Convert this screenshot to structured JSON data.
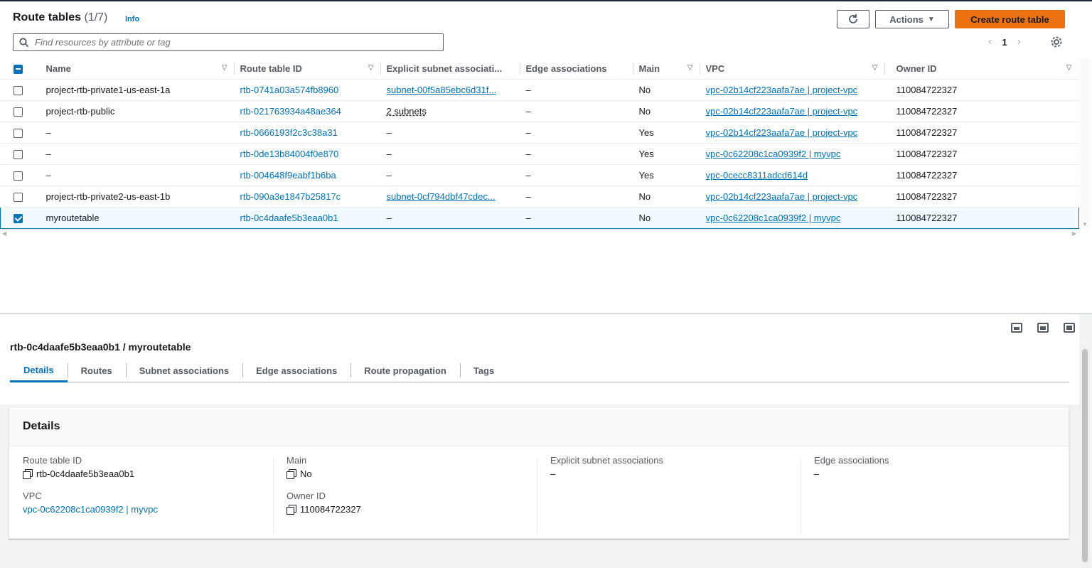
{
  "header": {
    "title": "Route tables",
    "count": "(1/7)",
    "info": "Info",
    "actions_label": "Actions",
    "create_label": "Create route table"
  },
  "search": {
    "placeholder": "Find resources by attribute or tag"
  },
  "pager": {
    "page": "1"
  },
  "table": {
    "columns": [
      "Name",
      "Route table ID",
      "Explicit subnet associati...",
      "Edge associations",
      "Main",
      "VPC",
      "Owner ID"
    ],
    "rows": [
      {
        "checked": false,
        "name": "project-rtb-private1-us-east-1a",
        "id": "rtb-0741a03a574fb8960",
        "subnet": "subnet-00f5a85ebc6d31f...",
        "edge": "–",
        "main": "No",
        "vpc": "vpc-02b14cf223aafa7ae | project-vpc",
        "owner": "110084722327"
      },
      {
        "checked": false,
        "name": "project-rtb-public",
        "id": "rtb-021763934a48ae364",
        "subnet": "2 subnets",
        "edge": "–",
        "main": "No",
        "vpc": "vpc-02b14cf223aafa7ae | project-vpc",
        "owner": "110084722327"
      },
      {
        "checked": false,
        "name": "–",
        "id": "rtb-0666193f2c3c38a31",
        "subnet": "–",
        "edge": "–",
        "main": "Yes",
        "vpc": "vpc-02b14cf223aafa7ae | project-vpc",
        "owner": "110084722327"
      },
      {
        "checked": false,
        "name": "–",
        "id": "rtb-0de13b84004f0e870",
        "subnet": "–",
        "edge": "–",
        "main": "Yes",
        "vpc": "vpc-0c62208c1ca0939f2 | myvpc",
        "owner": "110084722327"
      },
      {
        "checked": false,
        "name": "–",
        "id": "rtb-004648f9eabf1b6ba",
        "subnet": "–",
        "edge": "–",
        "main": "Yes",
        "vpc": "vpc-0cecc8311adcd614d",
        "owner": "110084722327"
      },
      {
        "checked": false,
        "name": "project-rtb-private2-us-east-1b",
        "id": "rtb-090a3e1847b25817c",
        "subnet": "subnet-0cf794dbf47cdec...",
        "edge": "–",
        "main": "No",
        "vpc": "vpc-02b14cf223aafa7ae | project-vpc",
        "owner": "110084722327"
      },
      {
        "checked": true,
        "name": "myroutetable",
        "id": "rtb-0c4daafe5b3eaa0b1",
        "subnet": "–",
        "edge": "–",
        "main": "No",
        "vpc": "vpc-0c62208c1ca0939f2 | myvpc",
        "owner": "110084722327"
      }
    ]
  },
  "detail": {
    "title": "rtb-0c4daafe5b3eaa0b1 / myroutetable",
    "tabs": [
      "Details",
      "Routes",
      "Subnet associations",
      "Edge associations",
      "Route propagation",
      "Tags"
    ],
    "card_title": "Details",
    "route_table_id_label": "Route table ID",
    "route_table_id": "rtb-0c4daafe5b3eaa0b1",
    "vpc_label": "VPC",
    "vpc": "vpc-0c62208c1ca0939f2 | myvpc",
    "main_label": "Main",
    "main": "No",
    "owner_label": "Owner ID",
    "owner": "110084722327",
    "explicit_label": "Explicit subnet associations",
    "explicit": "–",
    "edge_label": "Edge associations",
    "edge": "–"
  },
  "colors": {
    "link": "#0073bb",
    "primary": "#ec7211",
    "text": "#16191f"
  }
}
